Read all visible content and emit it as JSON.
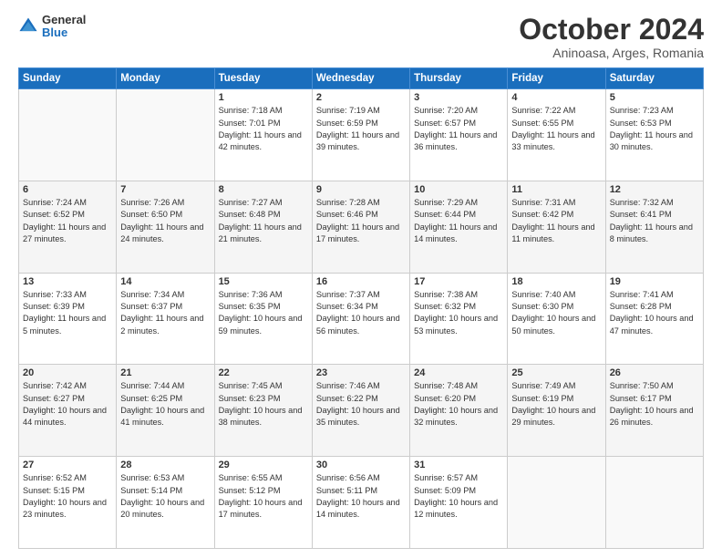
{
  "header": {
    "logo_line1": "General",
    "logo_line2": "Blue",
    "month": "October 2024",
    "location": "Aninoasa, Arges, Romania"
  },
  "weekdays": [
    "Sunday",
    "Monday",
    "Tuesday",
    "Wednesday",
    "Thursday",
    "Friday",
    "Saturday"
  ],
  "weeks": [
    [
      {
        "day": "",
        "info": ""
      },
      {
        "day": "",
        "info": ""
      },
      {
        "day": "1",
        "info": "Sunrise: 7:18 AM\nSunset: 7:01 PM\nDaylight: 11 hours and 42 minutes."
      },
      {
        "day": "2",
        "info": "Sunrise: 7:19 AM\nSunset: 6:59 PM\nDaylight: 11 hours and 39 minutes."
      },
      {
        "day": "3",
        "info": "Sunrise: 7:20 AM\nSunset: 6:57 PM\nDaylight: 11 hours and 36 minutes."
      },
      {
        "day": "4",
        "info": "Sunrise: 7:22 AM\nSunset: 6:55 PM\nDaylight: 11 hours and 33 minutes."
      },
      {
        "day": "5",
        "info": "Sunrise: 7:23 AM\nSunset: 6:53 PM\nDaylight: 11 hours and 30 minutes."
      }
    ],
    [
      {
        "day": "6",
        "info": "Sunrise: 7:24 AM\nSunset: 6:52 PM\nDaylight: 11 hours and 27 minutes."
      },
      {
        "day": "7",
        "info": "Sunrise: 7:26 AM\nSunset: 6:50 PM\nDaylight: 11 hours and 24 minutes."
      },
      {
        "day": "8",
        "info": "Sunrise: 7:27 AM\nSunset: 6:48 PM\nDaylight: 11 hours and 21 minutes."
      },
      {
        "day": "9",
        "info": "Sunrise: 7:28 AM\nSunset: 6:46 PM\nDaylight: 11 hours and 17 minutes."
      },
      {
        "day": "10",
        "info": "Sunrise: 7:29 AM\nSunset: 6:44 PM\nDaylight: 11 hours and 14 minutes."
      },
      {
        "day": "11",
        "info": "Sunrise: 7:31 AM\nSunset: 6:42 PM\nDaylight: 11 hours and 11 minutes."
      },
      {
        "day": "12",
        "info": "Sunrise: 7:32 AM\nSunset: 6:41 PM\nDaylight: 11 hours and 8 minutes."
      }
    ],
    [
      {
        "day": "13",
        "info": "Sunrise: 7:33 AM\nSunset: 6:39 PM\nDaylight: 11 hours and 5 minutes."
      },
      {
        "day": "14",
        "info": "Sunrise: 7:34 AM\nSunset: 6:37 PM\nDaylight: 11 hours and 2 minutes."
      },
      {
        "day": "15",
        "info": "Sunrise: 7:36 AM\nSunset: 6:35 PM\nDaylight: 10 hours and 59 minutes."
      },
      {
        "day": "16",
        "info": "Sunrise: 7:37 AM\nSunset: 6:34 PM\nDaylight: 10 hours and 56 minutes."
      },
      {
        "day": "17",
        "info": "Sunrise: 7:38 AM\nSunset: 6:32 PM\nDaylight: 10 hours and 53 minutes."
      },
      {
        "day": "18",
        "info": "Sunrise: 7:40 AM\nSunset: 6:30 PM\nDaylight: 10 hours and 50 minutes."
      },
      {
        "day": "19",
        "info": "Sunrise: 7:41 AM\nSunset: 6:28 PM\nDaylight: 10 hours and 47 minutes."
      }
    ],
    [
      {
        "day": "20",
        "info": "Sunrise: 7:42 AM\nSunset: 6:27 PM\nDaylight: 10 hours and 44 minutes."
      },
      {
        "day": "21",
        "info": "Sunrise: 7:44 AM\nSunset: 6:25 PM\nDaylight: 10 hours and 41 minutes."
      },
      {
        "day": "22",
        "info": "Sunrise: 7:45 AM\nSunset: 6:23 PM\nDaylight: 10 hours and 38 minutes."
      },
      {
        "day": "23",
        "info": "Sunrise: 7:46 AM\nSunset: 6:22 PM\nDaylight: 10 hours and 35 minutes."
      },
      {
        "day": "24",
        "info": "Sunrise: 7:48 AM\nSunset: 6:20 PM\nDaylight: 10 hours and 32 minutes."
      },
      {
        "day": "25",
        "info": "Sunrise: 7:49 AM\nSunset: 6:19 PM\nDaylight: 10 hours and 29 minutes."
      },
      {
        "day": "26",
        "info": "Sunrise: 7:50 AM\nSunset: 6:17 PM\nDaylight: 10 hours and 26 minutes."
      }
    ],
    [
      {
        "day": "27",
        "info": "Sunrise: 6:52 AM\nSunset: 5:15 PM\nDaylight: 10 hours and 23 minutes."
      },
      {
        "day": "28",
        "info": "Sunrise: 6:53 AM\nSunset: 5:14 PM\nDaylight: 10 hours and 20 minutes."
      },
      {
        "day": "29",
        "info": "Sunrise: 6:55 AM\nSunset: 5:12 PM\nDaylight: 10 hours and 17 minutes."
      },
      {
        "day": "30",
        "info": "Sunrise: 6:56 AM\nSunset: 5:11 PM\nDaylight: 10 hours and 14 minutes."
      },
      {
        "day": "31",
        "info": "Sunrise: 6:57 AM\nSunset: 5:09 PM\nDaylight: 10 hours and 12 minutes."
      },
      {
        "day": "",
        "info": ""
      },
      {
        "day": "",
        "info": ""
      }
    ]
  ]
}
